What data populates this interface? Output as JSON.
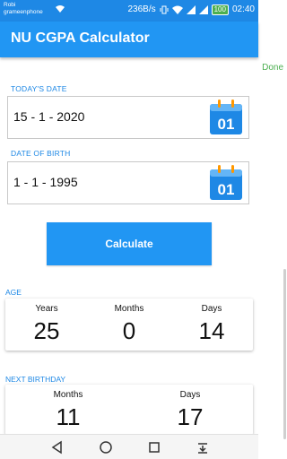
{
  "status_bar": {
    "carrier_line1": "Robi",
    "carrier_line2": "grameenphone",
    "network_speed": "236B/s",
    "battery": "100",
    "time": "02:40"
  },
  "app_bar": {
    "title": "NU CGPA Calculator"
  },
  "done_label": "Done",
  "todays_date": {
    "label": "TODAY'S DATE",
    "value": "15 - 1 - 2020",
    "calendar_day": "01"
  },
  "date_of_birth": {
    "label": "DATE OF BIRTH",
    "value": "1 - 1 - 1995",
    "calendar_day": "01"
  },
  "calculate_label": "Calculate",
  "age": {
    "label": "AGE",
    "years_label": "Years",
    "years": "25",
    "months_label": "Months",
    "months": "0",
    "days_label": "Days",
    "days": "14"
  },
  "next_birthday": {
    "label": "NEXT BIRTHDAY",
    "months_label": "Months",
    "months": "11",
    "days_label": "Days",
    "days": "17"
  },
  "colors": {
    "primary": "#2196f3",
    "status": "#1e88e5",
    "done": "#4caf50"
  }
}
